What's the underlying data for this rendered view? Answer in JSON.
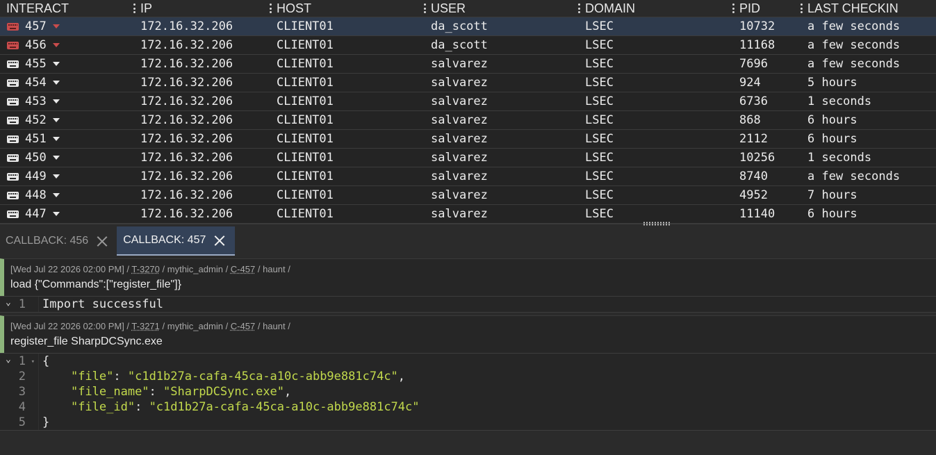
{
  "table": {
    "headers": [
      "INTERACT",
      "IP",
      "HOST",
      "USER",
      "DOMAIN",
      "PID",
      "LAST CHECKIN"
    ],
    "rows": [
      {
        "id": "457",
        "ip": "172.16.32.206",
        "host": "CLIENT01",
        "user": "da_scott",
        "domain": "LSEC",
        "pid": "10732",
        "last": "a few seconds",
        "alert": true,
        "selected": true
      },
      {
        "id": "456",
        "ip": "172.16.32.206",
        "host": "CLIENT01",
        "user": "da_scott",
        "domain": "LSEC",
        "pid": "11168",
        "last": "a few seconds",
        "alert": true,
        "selected": false
      },
      {
        "id": "455",
        "ip": "172.16.32.206",
        "host": "CLIENT01",
        "user": "salvarez",
        "domain": "LSEC",
        "pid": "7696",
        "last": "a few seconds",
        "alert": false,
        "selected": false
      },
      {
        "id": "454",
        "ip": "172.16.32.206",
        "host": "CLIENT01",
        "user": "salvarez",
        "domain": "LSEC",
        "pid": "924",
        "last": "5 hours",
        "alert": false,
        "selected": false
      },
      {
        "id": "453",
        "ip": "172.16.32.206",
        "host": "CLIENT01",
        "user": "salvarez",
        "domain": "LSEC",
        "pid": "6736",
        "last": "1 seconds",
        "alert": false,
        "selected": false
      },
      {
        "id": "452",
        "ip": "172.16.32.206",
        "host": "CLIENT01",
        "user": "salvarez",
        "domain": "LSEC",
        "pid": "868",
        "last": "6 hours",
        "alert": false,
        "selected": false
      },
      {
        "id": "451",
        "ip": "172.16.32.206",
        "host": "CLIENT01",
        "user": "salvarez",
        "domain": "LSEC",
        "pid": "2112",
        "last": "6 hours",
        "alert": false,
        "selected": false
      },
      {
        "id": "450",
        "ip": "172.16.32.206",
        "host": "CLIENT01",
        "user": "salvarez",
        "domain": "LSEC",
        "pid": "10256",
        "last": "1 seconds",
        "alert": false,
        "selected": false
      },
      {
        "id": "449",
        "ip": "172.16.32.206",
        "host": "CLIENT01",
        "user": "salvarez",
        "domain": "LSEC",
        "pid": "8740",
        "last": "a few seconds",
        "alert": false,
        "selected": false
      },
      {
        "id": "448",
        "ip": "172.16.32.206",
        "host": "CLIENT01",
        "user": "salvarez",
        "domain": "LSEC",
        "pid": "4952",
        "last": "7 hours",
        "alert": false,
        "selected": false
      },
      {
        "id": "447",
        "ip": "172.16.32.206",
        "host": "CLIENT01",
        "user": "salvarez",
        "domain": "LSEC",
        "pid": "11140",
        "last": "6 hours",
        "alert": false,
        "selected": false
      }
    ]
  },
  "tabs": [
    {
      "label": "CALLBACK: 456",
      "active": false
    },
    {
      "label": "CALLBACK: 457",
      "active": true
    }
  ],
  "tasks": [
    {
      "timestamp": "[Wed Jul 22 2026 02:00 PM]",
      "task_id": "T-3270",
      "operator": "mythic_admin",
      "callback_id": "C-457",
      "payload": "haunt",
      "command": "load {\"Commands\":[\"register_file\"]}",
      "output_lines": [
        "Import successful"
      ]
    },
    {
      "timestamp": "[Wed Jul 22 2026 02:00 PM]",
      "task_id": "T-3271",
      "operator": "mythic_admin",
      "callback_id": "C-457",
      "payload": "haunt",
      "command": "register_file SharpDCSync.exe",
      "output_lines": [
        "{",
        "    \"file\": \"c1d1b27a-cafa-45ca-a10c-abb9e881c74c\",",
        "    \"file_name\": \"SharpDCSync.exe\",",
        "    \"file_id\": \"c1d1b27a-cafa-45ca-a10c-abb9e881c74c\"",
        "}"
      ]
    }
  ],
  "colors": {
    "accent_tab": "#344258",
    "alert_red": "#c94c4c",
    "task_bar": "#8db57c",
    "json_green": "#c2d94c"
  },
  "separator": " / "
}
